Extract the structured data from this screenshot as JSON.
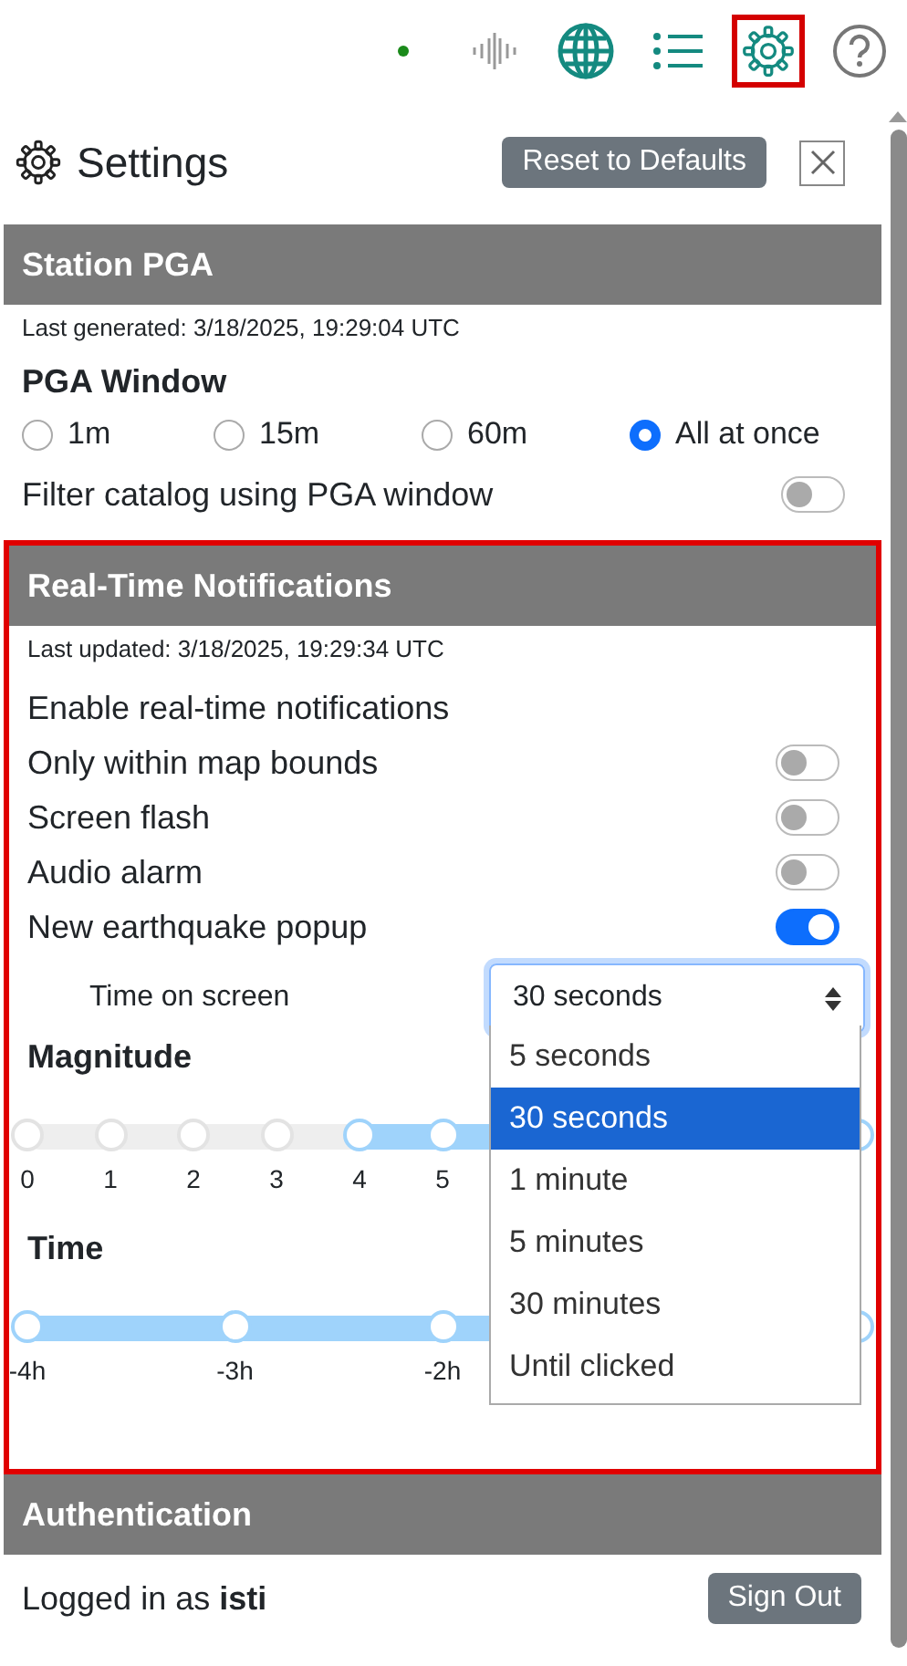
{
  "toolbar": [
    {
      "kind": "status",
      "highlighted": false
    },
    {
      "kind": "waveform",
      "highlighted": false
    },
    {
      "kind": "globe",
      "highlighted": false
    },
    {
      "kind": "list",
      "highlighted": false
    },
    {
      "kind": "settings",
      "highlighted": true
    },
    {
      "kind": "help",
      "highlighted": false
    }
  ],
  "panel": {
    "title": "Settings",
    "reset_button": "Reset to Defaults"
  },
  "station_pga": {
    "header": "Station PGA",
    "last_generated": "Last generated: 3/18/2025, 19:29:04 UTC",
    "window_label": "PGA Window",
    "options": [
      {
        "label": "1m",
        "selected": false
      },
      {
        "label": "15m",
        "selected": false
      },
      {
        "label": "60m",
        "selected": false
      },
      {
        "label": "All at once",
        "selected": true
      }
    ],
    "filter": {
      "label": "Filter catalog using PGA window",
      "on": false
    }
  },
  "notifications": {
    "header": "Real-Time Notifications",
    "highlighted": true,
    "last_updated": "Last updated: 3/18/2025, 19:29:34 UTC",
    "enable_label": "Enable real-time notifications",
    "toggles": [
      {
        "label": "Only within map bounds",
        "on": false
      },
      {
        "label": "Screen flash",
        "on": false
      },
      {
        "label": "Audio alarm",
        "on": false
      },
      {
        "label": "New earthquake popup",
        "on": true
      }
    ],
    "time_on_screen": {
      "label": "Time on screen",
      "value": "30 seconds",
      "expanded": true,
      "options": [
        {
          "label": "5 seconds",
          "selected": false
        },
        {
          "label": "30 seconds",
          "selected": true
        },
        {
          "label": "1 minute",
          "selected": false
        },
        {
          "label": "5 minutes",
          "selected": false
        },
        {
          "label": "30 minutes",
          "selected": false
        },
        {
          "label": "Until clicked",
          "selected": false
        }
      ]
    },
    "magnitude": {
      "label": "Magnitude",
      "level": 0.6,
      "ticks": [
        "0",
        "1",
        "2",
        "3",
        "4",
        "5"
      ]
    },
    "time": {
      "label": "Time",
      "level": 1,
      "ticks": [
        "-4h",
        "-3h",
        "-2h"
      ]
    }
  },
  "authentication": {
    "header": "Authentication",
    "logged_in": "Logged in as **isti**",
    "sign_out": "Sign Out"
  }
}
